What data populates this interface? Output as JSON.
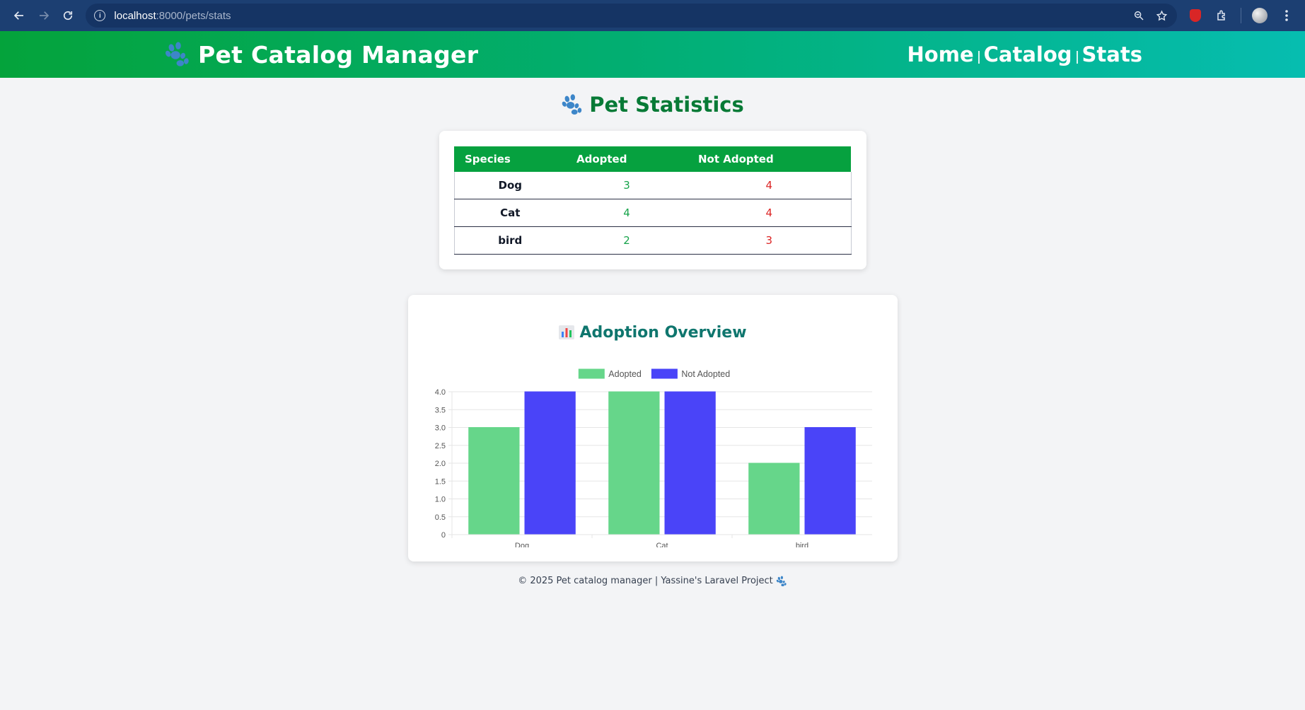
{
  "browser": {
    "url_host": "localhost",
    "url_path": ":8000/pets/stats"
  },
  "header": {
    "brand": "Pet Catalog Manager",
    "nav": [
      "Home",
      "Catalog",
      "Stats"
    ]
  },
  "page": {
    "title": "Pet Statistics"
  },
  "stats_table": {
    "headers": [
      "Species",
      "Adopted",
      "Not Adopted"
    ],
    "rows": [
      {
        "species": "Dog",
        "adopted": "3",
        "not_adopted": "4"
      },
      {
        "species": "Cat",
        "adopted": "4",
        "not_adopted": "4"
      },
      {
        "species": "bird",
        "adopted": "2",
        "not_adopted": "3"
      }
    ]
  },
  "chart_section": {
    "title": "Adoption Overview"
  },
  "chart_data": {
    "type": "bar",
    "categories": [
      "Dog",
      "Cat",
      "bird"
    ],
    "series": [
      {
        "name": "Adopted",
        "values": [
          3,
          4,
          2
        ],
        "color": "#66d68a"
      },
      {
        "name": "Not Adopted",
        "values": [
          4,
          4,
          3
        ],
        "color": "#4a44f8"
      }
    ],
    "ylim": [
      0,
      4
    ],
    "yticks": [
      "0",
      "0.5",
      "1.0",
      "1.5",
      "2.0",
      "2.5",
      "3.0",
      "3.5",
      "4.0"
    ],
    "legend": "top",
    "grid": true
  },
  "footer": {
    "text": "© 2025 Pet catalog manager | Yassine's Laravel Project"
  },
  "colors": {
    "header_start": "#04a33b",
    "header_end": "#06bdb0",
    "title_green": "#077a36",
    "chart_title": "#0f766e"
  }
}
